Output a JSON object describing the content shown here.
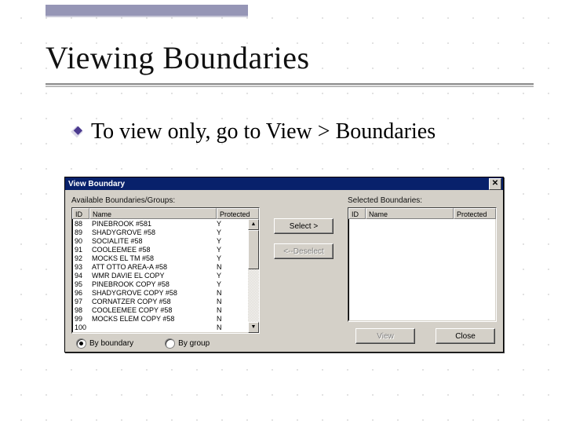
{
  "slide": {
    "title": "Viewing Boundaries",
    "bullet": "To view only, go to View > Boundaries"
  },
  "dialog": {
    "title": "View Boundary",
    "close": "✕",
    "available_label": "Available Boundaries/Groups:",
    "selected_label": "Selected Boundaries:",
    "columns": {
      "id": "ID",
      "name": "Name",
      "protected": "Protected"
    },
    "rows": [
      {
        "id": "88",
        "name": "PINEBROOK #581",
        "prot": "Y"
      },
      {
        "id": "89",
        "name": "SHADYGROVE #58",
        "prot": "Y"
      },
      {
        "id": "90",
        "name": "SOCIALITE #58",
        "prot": "Y"
      },
      {
        "id": "91",
        "name": "COOLEEMEE #58",
        "prot": "Y"
      },
      {
        "id": "92",
        "name": "MOCKS EL TM #58",
        "prot": "Y"
      },
      {
        "id": "93",
        "name": "ATT OTTO AREA-A #58",
        "prot": "N"
      },
      {
        "id": "94",
        "name": "WMR DAVIE EL COPY",
        "prot": "Y"
      },
      {
        "id": "95",
        "name": "PINEBROOK COPY #58",
        "prot": "Y"
      },
      {
        "id": "96",
        "name": "SHADYGROVE COPY #58",
        "prot": "N"
      },
      {
        "id": "97",
        "name": "CORNATZER COPY #58",
        "prot": "N"
      },
      {
        "id": "98",
        "name": "COOLEEMEE COPY #58",
        "prot": "N"
      },
      {
        "id": "99",
        "name": "MOCKS ELEM COPY #58",
        "prot": "N"
      },
      {
        "id": "100",
        "name": "",
        "prot": "N"
      }
    ],
    "buttons": {
      "select": "Select >",
      "deselect": "<--Deselect",
      "view": "View",
      "close_btn": "Close"
    },
    "radios": {
      "by_boundary": "By boundary",
      "by_group": "By group"
    }
  }
}
